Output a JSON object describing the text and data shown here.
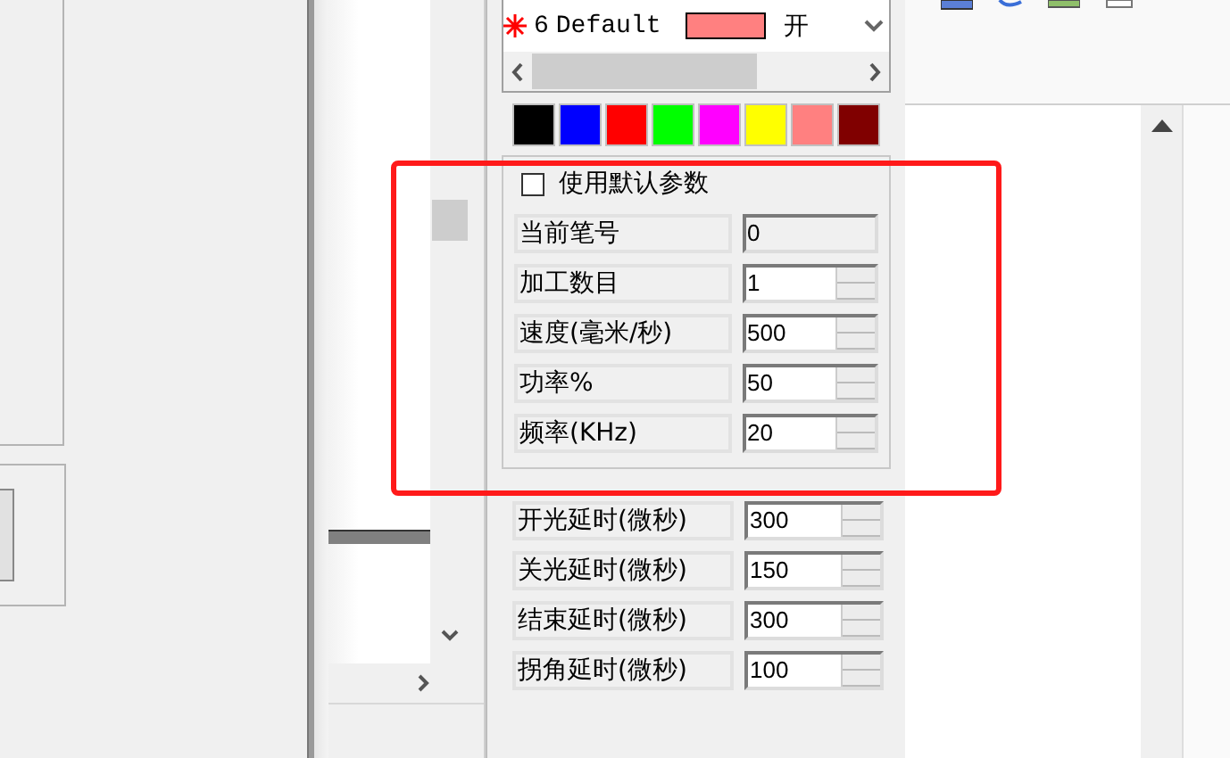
{
  "pen_list": {
    "rows": [
      {
        "number": "6",
        "name": "Default",
        "color": "#ff8080",
        "state": "开"
      }
    ]
  },
  "palette": [
    {
      "color": "#000000"
    },
    {
      "color": "#0000ff"
    },
    {
      "color": "#ff0000"
    },
    {
      "color": "#00ff00"
    },
    {
      "color": "#ff00ff"
    },
    {
      "color": "#ffff00"
    },
    {
      "color": "#ff8080"
    },
    {
      "color": "#800000"
    }
  ],
  "params": {
    "use_default": {
      "label": "使用默认参数",
      "checked": false
    },
    "fields": [
      {
        "label": "当前笔号",
        "value": "0",
        "kind": "readonly"
      },
      {
        "label": "加工数目",
        "value": "1",
        "kind": "spin"
      },
      {
        "label": "速度(毫米/秒)",
        "value": "500",
        "kind": "spin"
      },
      {
        "label": "功率%",
        "value": "50",
        "kind": "spin"
      },
      {
        "label": "频率(KHz)",
        "value": "20",
        "kind": "spin"
      }
    ]
  },
  "delays": [
    {
      "label": "开光延时(微秒)",
      "value": "300",
      "kind": "spin"
    },
    {
      "label": "关光延时(微秒)",
      "value": "150",
      "kind": "spin"
    },
    {
      "label": "结束延时(微秒)",
      "value": "300",
      "kind": "spin"
    },
    {
      "label": "拐角延时(微秒)",
      "value": "100",
      "kind": "spin"
    }
  ]
}
